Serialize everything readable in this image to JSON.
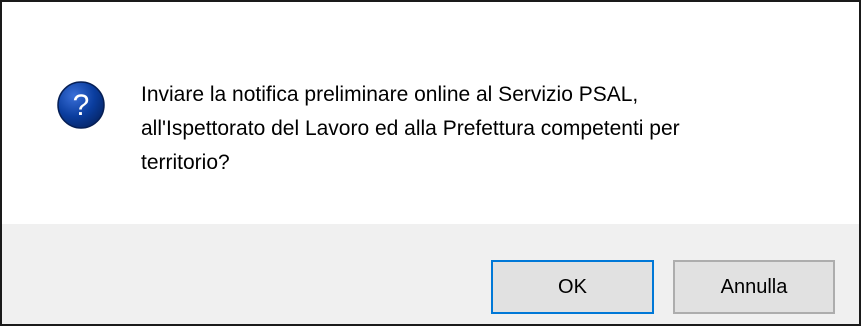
{
  "dialog": {
    "icon": "question-icon",
    "icon_glyph": "?",
    "icon_color": "#0a3d9e",
    "message_lines": [
      "Inviare la notifica preliminare online al Servizio PSAL,",
      "all'Ispettorato del Lavoro ed alla Prefettura competenti per",
      "territorio?"
    ]
  },
  "buttons": {
    "ok_label": "OK",
    "cancel_label": "Annulla"
  }
}
